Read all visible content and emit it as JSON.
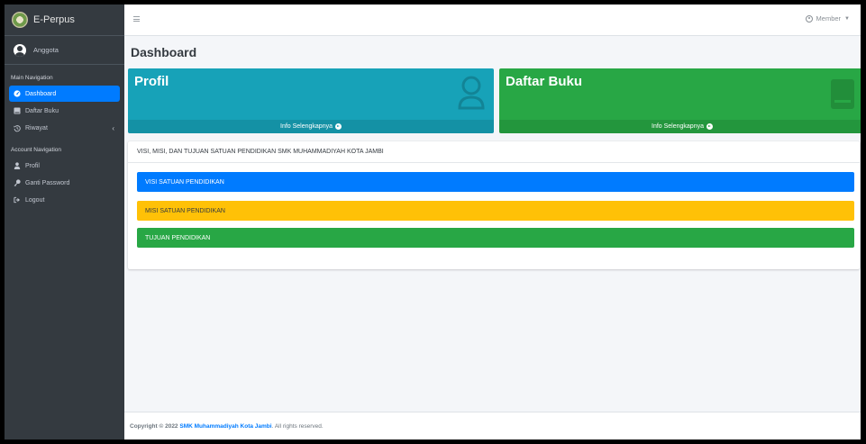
{
  "brand": {
    "name": "E-Perpus"
  },
  "user": {
    "name": "Anggota"
  },
  "topbar": {
    "member_label": "Member"
  },
  "sidebar": {
    "main_header": "Main Navigation",
    "main_items": [
      {
        "label": "Dashboard",
        "icon": "dashboard-icon",
        "active": true
      },
      {
        "label": "Daftar Buku",
        "icon": "book-icon",
        "active": false
      },
      {
        "label": "Riwayat",
        "icon": "history-icon",
        "active": false
      }
    ],
    "account_header": "Account Navigation",
    "account_items": [
      {
        "label": "Profil",
        "icon": "user-icon"
      },
      {
        "label": "Ganti Password",
        "icon": "key-icon"
      },
      {
        "label": "Logout",
        "icon": "logout-icon"
      }
    ]
  },
  "main": {
    "page_title": "Dashboard",
    "boxes": [
      {
        "title": "Profil",
        "link": "Info Selengkapnya",
        "color": "#17a2b8"
      },
      {
        "title": "Daftar Buku",
        "link": "Info Selengkapnya",
        "color": "#28a745"
      }
    ],
    "card": {
      "header": "VISI, MISI, DAN TUJUAN SATUAN PENDIDIKAN SMK MUHAMMADIYAH KOTA JAMBI",
      "bars": [
        {
          "label": "VISI SATUAN PENDIDIKAN",
          "color": "#007bff"
        },
        {
          "label": "MISI SATUAN PENDIDIKAN",
          "color": "#ffc107"
        },
        {
          "label": "TUJUAN PENDIDIKAN",
          "color": "#28a745"
        }
      ]
    }
  },
  "footer": {
    "prefix": "Copyright © 2022",
    "org": "SMK Muhammadiyah Kota Jambi",
    "suffix": ". All rights reserved."
  }
}
